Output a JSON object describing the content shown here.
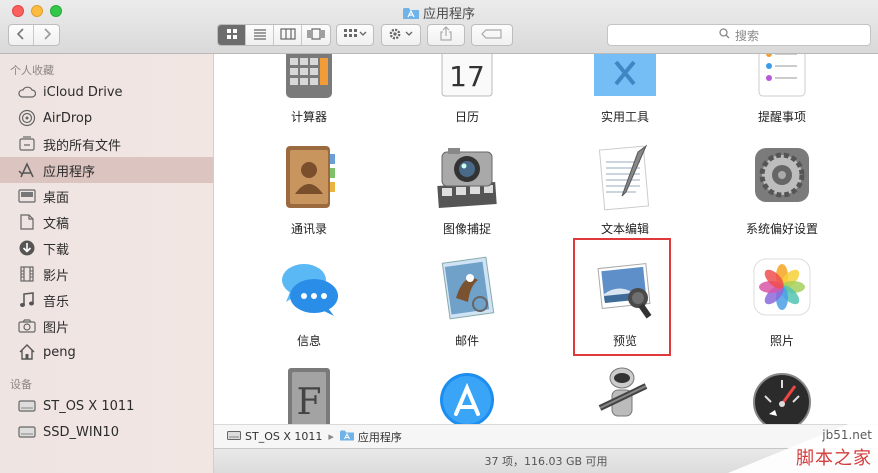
{
  "window": {
    "title": "应用程序",
    "controls": [
      "close",
      "minimize",
      "zoom"
    ]
  },
  "toolbar": {
    "nav": [
      "back-icon",
      "forward-icon"
    ],
    "view_modes": [
      "icon-view-icon",
      "list-view-icon",
      "column-view-icon",
      "cover-flow-icon"
    ],
    "active_view": "icon-view-icon",
    "arrange_icon": "arrange-icon",
    "action_icon": "gear-icon",
    "share_icon": "share-icon",
    "tag_icon": "tag-icon",
    "search_placeholder": "搜索"
  },
  "sidebar": {
    "favorites_header": "个人收藏",
    "favorites": [
      {
        "label": "iCloud Drive",
        "icon": "cloud-icon"
      },
      {
        "label": "AirDrop",
        "icon": "airdrop-icon"
      },
      {
        "label": "我的所有文件",
        "icon": "all-files-icon"
      },
      {
        "label": "应用程序",
        "icon": "applications-icon",
        "selected": true
      },
      {
        "label": "桌面",
        "icon": "desktop-icon"
      },
      {
        "label": "文稿",
        "icon": "documents-icon"
      },
      {
        "label": "下载",
        "icon": "download-icon"
      },
      {
        "label": "影片",
        "icon": "movies-icon"
      },
      {
        "label": "音乐",
        "icon": "music-icon"
      },
      {
        "label": "图片",
        "icon": "pictures-icon"
      },
      {
        "label": "peng",
        "icon": "home-icon"
      }
    ],
    "devices_header": "设备",
    "devices": [
      {
        "label": "ST_OS X 1011",
        "icon": "disk-icon"
      },
      {
        "label": "SSD_WIN10",
        "icon": "disk-icon"
      }
    ]
  },
  "apps": [
    {
      "label": "计算器",
      "icon": "calculator-icon"
    },
    {
      "label": "日历",
      "icon": "calendar-icon",
      "glyph": "17"
    },
    {
      "label": "实用工具",
      "icon": "utilities-folder-icon"
    },
    {
      "label": "提醒事项",
      "icon": "reminders-icon"
    },
    {
      "label": "通讯录",
      "icon": "contacts-icon"
    },
    {
      "label": "图像捕捉",
      "icon": "image-capture-icon"
    },
    {
      "label": "文本编辑",
      "icon": "textedit-icon"
    },
    {
      "label": "系统偏好设置",
      "icon": "system-preferences-icon"
    },
    {
      "label": "信息",
      "icon": "messages-icon"
    },
    {
      "label": "邮件",
      "icon": "mail-icon"
    },
    {
      "label": "预览",
      "icon": "preview-icon",
      "highlighted": true
    },
    {
      "label": "照片",
      "icon": "photos-icon"
    },
    {
      "label": "",
      "icon": "font-book-icon",
      "glyph": "F"
    },
    {
      "label": "",
      "icon": "app-store-icon"
    },
    {
      "label": "",
      "icon": "automator-icon"
    },
    {
      "label": "",
      "icon": "dashboard-icon"
    }
  ],
  "pathbar": {
    "items": [
      "ST_OS X 1011",
      "应用程序"
    ],
    "separator": "▸"
  },
  "status": "37 项，116.03 GB 可用",
  "watermark": {
    "domain": "jb51.net",
    "name": "脚本之家"
  },
  "colors": {
    "sidebar_selected": "#dcc4c0",
    "highlight_border": "#e0393c"
  }
}
